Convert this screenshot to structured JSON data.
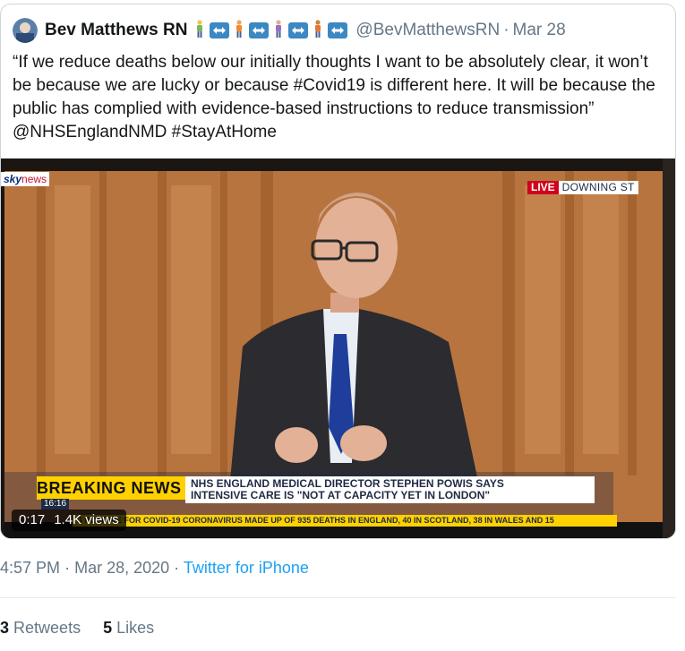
{
  "tweet": {
    "author_name": "Bev Matthews RN",
    "handle": "@BevMatthewsRN",
    "separator": "·",
    "date": "Mar 28",
    "text": "“If we reduce deaths below our initially thoughts I want to be absolutely clear, it won’t be because we are lucky or because #Covid19 is different here. It will be because the public has complied with evidence-based instructions to reduce transmission” @NHSEnglandNMD #StayAtHome",
    "name_emojis": [
      "person-icon",
      "left-right-arrow-icon",
      "person-icon",
      "left-right-arrow-icon",
      "person-icon",
      "left-right-arrow-icon",
      "person-icon",
      "left-right-arrow-icon"
    ]
  },
  "media": {
    "channel_sky": "sky",
    "channel_news": "news",
    "live_label": "LIVE",
    "location": "DOWNING ST",
    "breaking_label": "BREAKING NEWS",
    "headline_line1": "NHS ENGLAND MEDICAL DIRECTOR STEPHEN POWIS SAYS",
    "headline_line2": "INTENSIVE CARE IS \"NOT AT CAPACITY YET IN LONDON\"",
    "ticker_time": "16:16",
    "ticker_text": "G POSITIVE FOR COVID-19 CORONAVIRUS MADE UP OF 935 DEATHS IN ENGLAND, 40 IN SCOTLAND, 38 IN WALES AND 15",
    "video_time": "0:17",
    "video_views": "1.4K views"
  },
  "meta": {
    "time": "4:57 PM",
    "separator": "·",
    "full_date": "Mar 28, 2020",
    "source": "Twitter for iPhone"
  },
  "stats": {
    "retweets_count": "3",
    "retweets_label": "Retweets",
    "likes_count": "5",
    "likes_label": "Likes"
  },
  "colors": {
    "link": "#1da1f2",
    "muted": "#657786",
    "breaking_yellow": "#ffd100",
    "live_red": "#d0021b"
  }
}
